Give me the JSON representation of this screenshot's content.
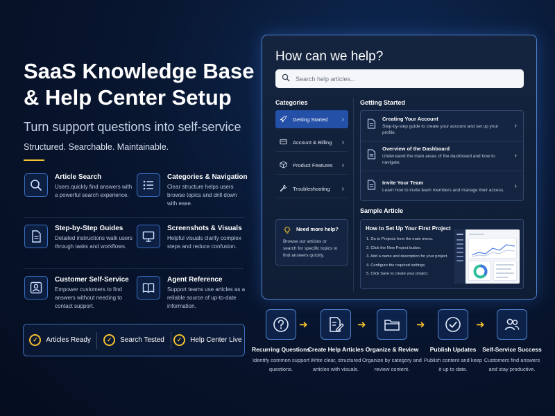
{
  "hero": {
    "title": "SaaS Knowledge Base & Help Center Setup",
    "subtitle": "Turn support questions into self-service",
    "tagline": "Structured. Searchable. Maintainable."
  },
  "features": [
    {
      "title": "Article Search",
      "desc": "Users quickly find answers with a powerful search experience.",
      "icon": "search-icon"
    },
    {
      "title": "Categories & Navigation",
      "desc": "Clear structure helps users browse topics and drill down with ease.",
      "icon": "list-icon"
    },
    {
      "title": "Step-by-Step Guides",
      "desc": "Detailed instructions walk users through tasks and workflows.",
      "icon": "document-icon"
    },
    {
      "title": "Screenshots & Visuals",
      "desc": "Helpful visuals clarify complex steps and reduce confusion.",
      "icon": "monitor-icon"
    },
    {
      "title": "Customer Self-Service",
      "desc": "Empower customers to find answers without needing to contact support.",
      "icon": "user-icon"
    },
    {
      "title": "Agent Reference",
      "desc": "Support teams use articles as a reliable source of up-to-date information.",
      "icon": "book-icon"
    }
  ],
  "status": [
    "Articles Ready",
    "Search Tested",
    "Help Center Live"
  ],
  "help_center": {
    "title": "How can we help?",
    "search_placeholder": "Search help articles...",
    "categories_heading": "Categories",
    "categories": [
      {
        "label": "Getting Started",
        "icon": "rocket-icon",
        "active": true
      },
      {
        "label": "Account & Billing",
        "icon": "credit-card-icon",
        "active": false
      },
      {
        "label": "Product Features",
        "icon": "box-icon",
        "active": false
      },
      {
        "label": "Troubleshooting",
        "icon": "wrench-icon",
        "active": false
      }
    ],
    "need_help": {
      "title": "Need more help?",
      "desc": "Browse our articles or search for specific topics to find answers quickly."
    },
    "getting_started_heading": "Getting Started",
    "articles": [
      {
        "title": "Creating Your Account",
        "desc": "Step-by-step guide to create your account and set up your profile."
      },
      {
        "title": "Overview of the Dashboard",
        "desc": "Understand the main areas of the dashboard and how to navigate."
      },
      {
        "title": "Invite Your Team",
        "desc": "Learn how to invite team members and manage their access."
      }
    ],
    "sample_heading": "Sample Article",
    "sample": {
      "title": "How to Set Up Your First Project",
      "steps": [
        "1.  Go to Projects from the main menu.",
        "2.  Click the New Project button.",
        "3.  Add a name and description for your project.",
        "4.  Configure the required settings.",
        "5.  Click Save to create your project."
      ]
    }
  },
  "workflow": [
    {
      "title": "Recurring Questions",
      "desc": "Identify common support questions.",
      "icon": "question-icon"
    },
    {
      "title": "Create Help Articles",
      "desc": "Write clear, structured articles with visuals.",
      "icon": "edit-document-icon"
    },
    {
      "title": "Organize & Review",
      "desc": "Organize by category and review content.",
      "icon": "folder-icon"
    },
    {
      "title": "Publish Updates",
      "desc": "Publish content and keep it up to date.",
      "icon": "check-circle-icon"
    },
    {
      "title": "Self-Service Success",
      "desc": "Customers find answers and stay productive.",
      "icon": "users-icon"
    }
  ],
  "colors": {
    "accent": "#f5c12e",
    "primary": "#2450a8",
    "border": "#4f82cf",
    "background": "#081630"
  }
}
